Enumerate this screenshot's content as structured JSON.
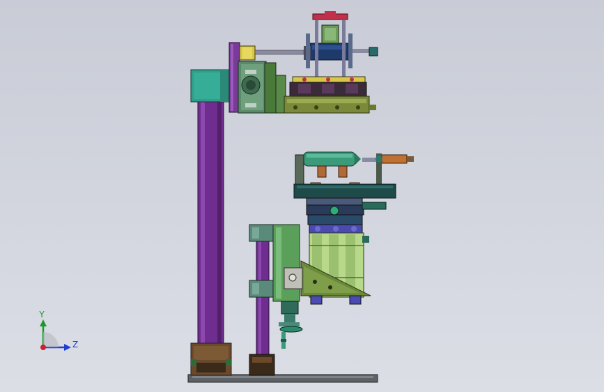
{
  "view": {
    "background_top": "#c9ccd6",
    "background_bottom": "#dcdee6"
  },
  "triad": {
    "y_label": "Y",
    "z_label": "Z",
    "y_color": "#1a9a2a",
    "z_color": "#1f3fd0",
    "x_color": "#d0202a"
  },
  "palette": {
    "column_purple": "#6f2d8f",
    "panel_teal": "#2f9f8a",
    "body_olive": "#7a8a3a",
    "body_green": "#5aa05a",
    "steel_blue": "#2f5f8a",
    "accent_red": "#c0304a",
    "accent_yellow": "#d8c84a",
    "base_gray": "#6a6e72"
  }
}
